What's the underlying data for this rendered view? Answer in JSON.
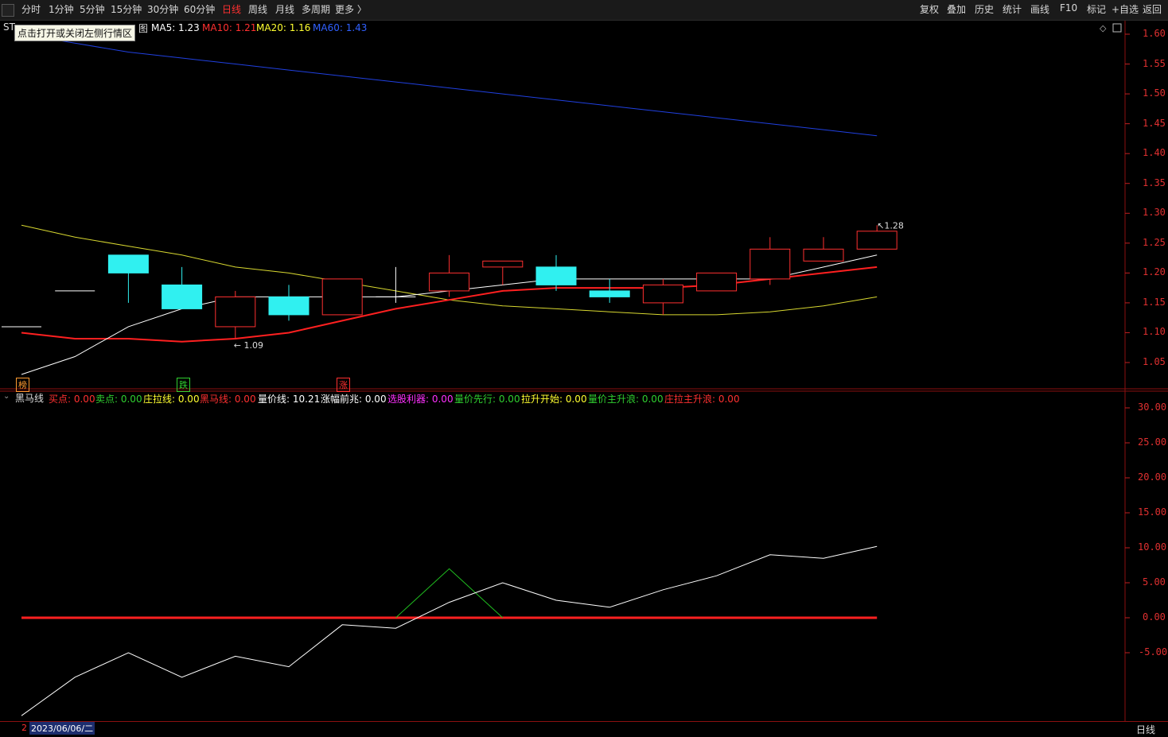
{
  "toolbar": {
    "periods": [
      "分时",
      "1分钟",
      "5分钟",
      "15分钟",
      "30分钟",
      "60分钟",
      "日线",
      "周线",
      "月线",
      "多周期",
      "更多 〉"
    ],
    "active_period": "日线",
    "actions": [
      "复权",
      "叠加",
      "历史",
      "统计",
      "画线",
      "F10",
      "标记",
      "+自选",
      "返回"
    ]
  },
  "main_panel": {
    "title_fragment": "ST",
    "title_suffix": "图",
    "tooltip": "点击打开或关闭左侧行情区",
    "ma": [
      {
        "label": "MA5: 1.23",
        "color": "#ffffff"
      },
      {
        "label": "MA10: 1.21",
        "color": "#ff3030"
      },
      {
        "label": "MA20: 1.16",
        "color": "#ffff30"
      },
      {
        "label": "MA60: 1.43",
        "color": "#3060ff"
      }
    ],
    "price_axis": [
      "1.60",
      "1.55",
      "1.50",
      "1.45",
      "1.40",
      "1.35",
      "1.30",
      "1.25",
      "1.20",
      "1.15",
      "1.10",
      "1.05"
    ],
    "high_label": "1.28",
    "low_label": "1.09",
    "signals": [
      {
        "text": "榜",
        "color": "#ff9b30"
      },
      {
        "text": "跌",
        "color": "#30d030"
      },
      {
        "text": "涨",
        "color": "#ff3030"
      }
    ]
  },
  "indicator_panel": {
    "name": "黑马线",
    "values": [
      {
        "label": "买点: 0.00",
        "color": "#ff3030"
      },
      {
        "label": "卖点: 0.00",
        "color": "#30d030"
      },
      {
        "label": "庄拉线: 0.00",
        "color": "#ffff30"
      },
      {
        "label": "黑马线: 0.00",
        "color": "#ff3030"
      },
      {
        "label": "量价线: 10.21",
        "color": "#ffffff"
      },
      {
        "label": "涨幅前兆: 0.00",
        "color": "#ffffff"
      },
      {
        "label": "选股利器: 0.00",
        "color": "#ff30ff"
      },
      {
        "label": "量价先行: 0.00",
        "color": "#30d030"
      },
      {
        "label": "拉升开始: 0.00",
        "color": "#ffff30"
      },
      {
        "label": "量价主升浪: 0.00",
        "color": "#30d030"
      },
      {
        "label": "庄拉主升浪: 0.00",
        "color": "#ff3030"
      }
    ],
    "axis": [
      "30.00",
      "25.00",
      "20.00",
      "15.00",
      "10.00",
      "5.00",
      "0.00",
      "-5.00"
    ]
  },
  "footer": {
    "date": "2023/06/06/二",
    "period": "日线"
  },
  "chart_data": [
    {
      "type": "candlestick",
      "ylim": [
        1.0,
        1.62
      ],
      "candles": [
        {
          "o": 1.11,
          "c": 1.11,
          "h": 1.11,
          "l": 1.11,
          "up": false
        },
        {
          "o": 1.17,
          "c": 1.17,
          "h": 1.17,
          "l": 1.17,
          "up": false
        },
        {
          "o": 1.23,
          "c": 1.2,
          "h": 1.23,
          "l": 1.15,
          "up": false
        },
        {
          "o": 1.18,
          "c": 1.14,
          "h": 1.21,
          "l": 1.14,
          "up": false
        },
        {
          "o": 1.11,
          "c": 1.16,
          "h": 1.17,
          "l": 1.09,
          "up": true
        },
        {
          "o": 1.16,
          "c": 1.13,
          "h": 1.18,
          "l": 1.12,
          "up": false
        },
        {
          "o": 1.13,
          "c": 1.19,
          "h": 1.19,
          "l": 1.13,
          "up": true
        },
        {
          "o": 1.16,
          "c": 1.16,
          "h": 1.21,
          "l": 1.15,
          "up": false
        },
        {
          "o": 1.17,
          "c": 1.2,
          "h": 1.23,
          "l": 1.16,
          "up": true
        },
        {
          "o": 1.21,
          "c": 1.22,
          "h": 1.22,
          "l": 1.18,
          "up": true
        },
        {
          "o": 1.21,
          "c": 1.18,
          "h": 1.23,
          "l": 1.17,
          "up": false
        },
        {
          "o": 1.17,
          "c": 1.16,
          "h": 1.19,
          "l": 1.15,
          "up": false
        },
        {
          "o": 1.15,
          "c": 1.18,
          "h": 1.19,
          "l": 1.13,
          "up": true
        },
        {
          "o": 1.17,
          "c": 1.2,
          "h": 1.2,
          "l": 1.17,
          "up": true
        },
        {
          "o": 1.19,
          "c": 1.24,
          "h": 1.26,
          "l": 1.18,
          "up": true
        },
        {
          "o": 1.22,
          "c": 1.24,
          "h": 1.26,
          "l": 1.22,
          "up": true
        },
        {
          "o": 1.24,
          "c": 1.27,
          "h": 1.28,
          "l": 1.24,
          "up": true
        }
      ],
      "ma5": [
        1.03,
        1.06,
        1.11,
        1.14,
        1.16,
        1.16,
        1.16,
        1.16,
        1.17,
        1.18,
        1.19,
        1.19,
        1.19,
        1.19,
        1.19,
        1.21,
        1.23
      ],
      "ma10": [
        1.1,
        1.09,
        1.09,
        1.085,
        1.09,
        1.1,
        1.12,
        1.14,
        1.155,
        1.17,
        1.175,
        1.175,
        1.175,
        1.18,
        1.19,
        1.2,
        1.21
      ],
      "ma20": [
        1.28,
        1.26,
        1.245,
        1.23,
        1.21,
        1.2,
        1.185,
        1.17,
        1.155,
        1.145,
        1.14,
        1.135,
        1.13,
        1.13,
        1.135,
        1.145,
        1.16
      ],
      "ma60": [
        1.6,
        1.585,
        1.57,
        1.56,
        1.55,
        1.54,
        1.53,
        1.52,
        1.51,
        1.5,
        1.49,
        1.48,
        1.47,
        1.46,
        1.45,
        1.44,
        1.43
      ]
    },
    {
      "type": "line",
      "ylim": [
        -14,
        33
      ],
      "series": [
        {
          "name": "量价线",
          "color": "#ffffff",
          "values": [
            -14,
            -8.5,
            -5,
            -8.5,
            -5.5,
            -7,
            -1,
            -1.5,
            2.2,
            5,
            2.5,
            1.5,
            4,
            6,
            9,
            8.5,
            10.21
          ]
        },
        {
          "name": "卖点",
          "color": "#30d030",
          "values": [
            null,
            null,
            null,
            null,
            null,
            null,
            null,
            0,
            7,
            0,
            null,
            null,
            null,
            null,
            null,
            null,
            null
          ]
        },
        {
          "name": "黑马线",
          "color": "#ff2020",
          "values": [
            0,
            0,
            0,
            0,
            0,
            0,
            0,
            0,
            0,
            0,
            0,
            0,
            0,
            0,
            0,
            0,
            0
          ]
        }
      ]
    }
  ]
}
